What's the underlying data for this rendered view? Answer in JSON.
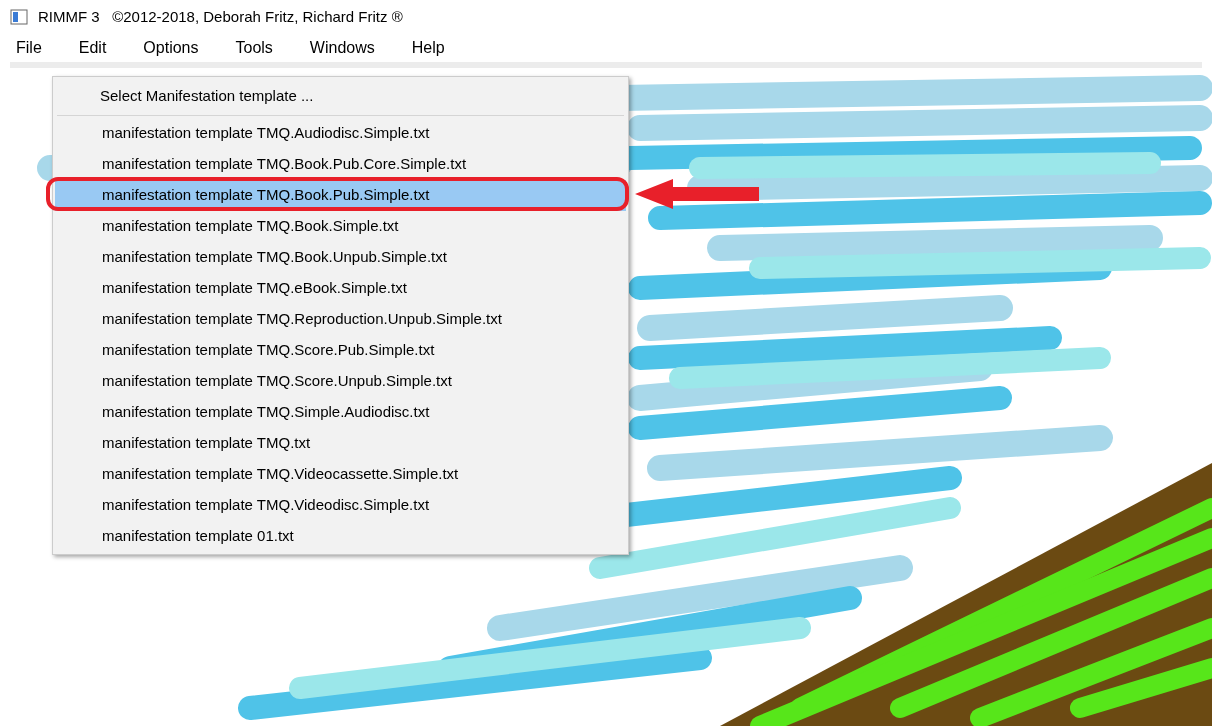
{
  "window": {
    "title": "RIMMF 3   ©2012-2018, Deborah Fritz, Richard Fritz ®"
  },
  "menu_bar": [
    "File",
    "Edit",
    "Options",
    "Tools",
    "Windows",
    "Help"
  ],
  "popup_menu": {
    "header": "Select Manifestation template ...",
    "items": [
      {
        "label": "manifestation template TMQ.Audiodisc.Simple.txt",
        "selected": false
      },
      {
        "label": "manifestation template TMQ.Book.Pub.Core.Simple.txt",
        "selected": false
      },
      {
        "label": "manifestation template TMQ.Book.Pub.Simple.txt",
        "selected": true
      },
      {
        "label": "manifestation template TMQ.Book.Simple.txt",
        "selected": false
      },
      {
        "label": "manifestation template TMQ.Book.Unpub.Simple.txt",
        "selected": false
      },
      {
        "label": "manifestation template TMQ.eBook.Simple.txt",
        "selected": false
      },
      {
        "label": "manifestation template TMQ.Reproduction.Unpub.Simple.txt",
        "selected": false
      },
      {
        "label": "manifestation template TMQ.Score.Pub.Simple.txt",
        "selected": false
      },
      {
        "label": "manifestation template TMQ.Score.Unpub.Simple.txt",
        "selected": false
      },
      {
        "label": "manifestation template TMQ.Simple.Audiodisc.txt",
        "selected": false
      },
      {
        "label": "manifestation template TMQ.txt",
        "selected": false
      },
      {
        "label": "manifestation template TMQ.Videocassette.Simple.txt",
        "selected": false
      },
      {
        "label": "manifestation template TMQ.Videodisc.Simple.txt",
        "selected": false
      },
      {
        "label": "manifestation template 01.txt",
        "selected": false
      }
    ]
  }
}
